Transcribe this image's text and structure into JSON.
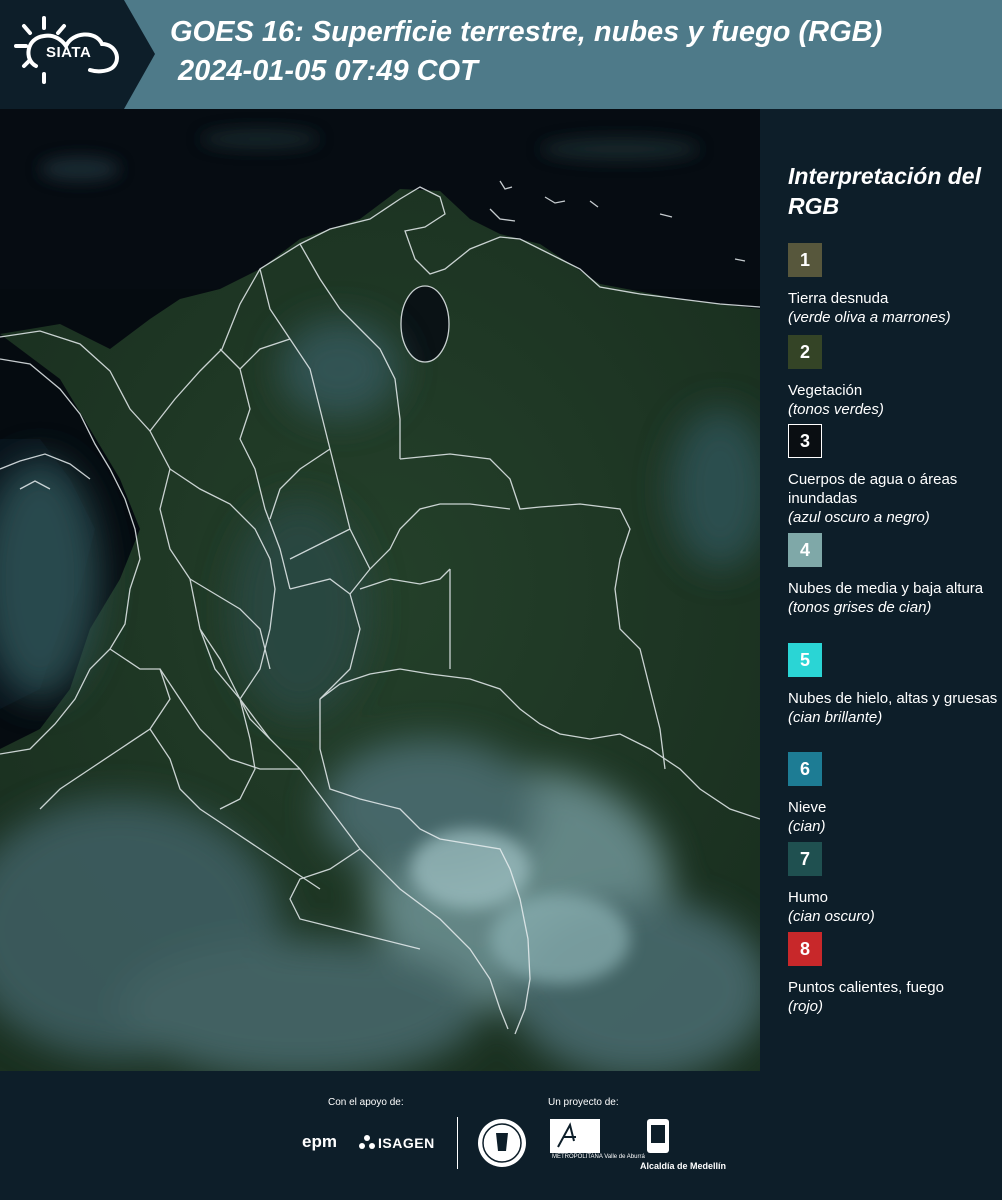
{
  "header": {
    "logo": "SIATA",
    "title_line1": "GOES 16: Superficie terrestre, nubes y fuego (RGB)",
    "title_line2": "2024-01-05 07:49 COT"
  },
  "legend": {
    "title": "Interpretación del RGB",
    "items": [
      {
        "number": "1",
        "name": "Tierra desnuda",
        "desc": "(verde oliva a marrones)",
        "color": "#57573c"
      },
      {
        "number": "2",
        "name": "Vegetación",
        "desc": "(tonos verdes)",
        "color": "#344426"
      },
      {
        "number": "3",
        "name": "Cuerpos de agua o áreas inundadas",
        "desc": "(azul oscuro a negro)",
        "color": "#0a0e12"
      },
      {
        "number": "4",
        "name": "Nubes de media y baja altura",
        "desc": "(tonos grises de cian)",
        "color": "#7fa8a8"
      },
      {
        "number": "5",
        "name": "Nubes de hielo, altas y gruesas",
        "desc": "(cian brillante)",
        "color": "#2ad5d5"
      },
      {
        "number": "6",
        "name": "Nieve",
        "desc": "(cian)",
        "color": "#1d7c94"
      },
      {
        "number": "7",
        "name": "Humo",
        "desc": "(cian oscuro)",
        "color": "#1f5050"
      },
      {
        "number": "8",
        "name": "Puntos calientes, fuego",
        "desc": "(rojo)",
        "color": "#c8282a"
      }
    ]
  },
  "footer": {
    "support_label": "Con el apoyo de:",
    "project_label": "Un proyecto de:",
    "sponsors": [
      "epm",
      "ISAGEN"
    ],
    "partners": [
      "Área Metropolitana",
      "Alcaldía de Medellín"
    ],
    "epm_text": "epm",
    "isagen_text": "ISAGEN",
    "metro_text": "METROPOLITANA Valle de Aburrá",
    "medellin_text": "Alcaldía de Medellín"
  }
}
